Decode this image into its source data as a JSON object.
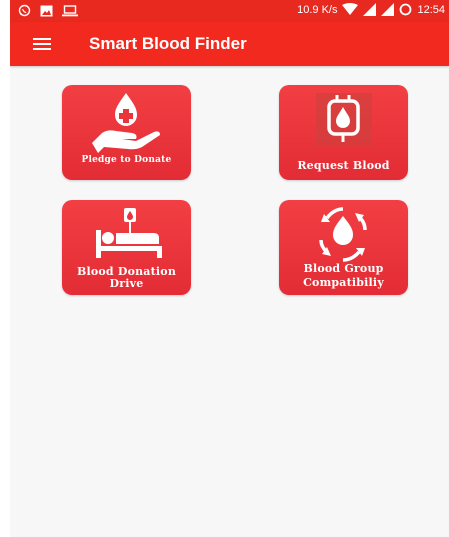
{
  "status_bar": {
    "speed": "10.9 K/s",
    "time": "12:54",
    "icons": [
      "whatsapp-icon",
      "image-icon",
      "laptop-icon",
      "wifi-icon",
      "signal-icon",
      "signal-icon",
      "sync-icon"
    ]
  },
  "app_bar": {
    "title": "Smart Blood Finder",
    "menu_icon": "hamburger-menu-icon"
  },
  "tiles": [
    {
      "label": "Pledge to Donate",
      "icon": "hand-blood-drop-icon"
    },
    {
      "label": "Request Blood",
      "icon": "blood-bag-icon"
    },
    {
      "label_lines": [
        "Blood Donation",
        "Drive"
      ],
      "icon": "patient-bed-iv-icon"
    },
    {
      "label_lines": [
        "Blood Group",
        "Compatibiliy"
      ],
      "icon": "blood-drop-cycle-icon"
    }
  ],
  "colors": {
    "status_bar": "#e8291f",
    "app_bar": "#f2291f",
    "tile": "#e8353a",
    "background": "#f7f7f7"
  }
}
